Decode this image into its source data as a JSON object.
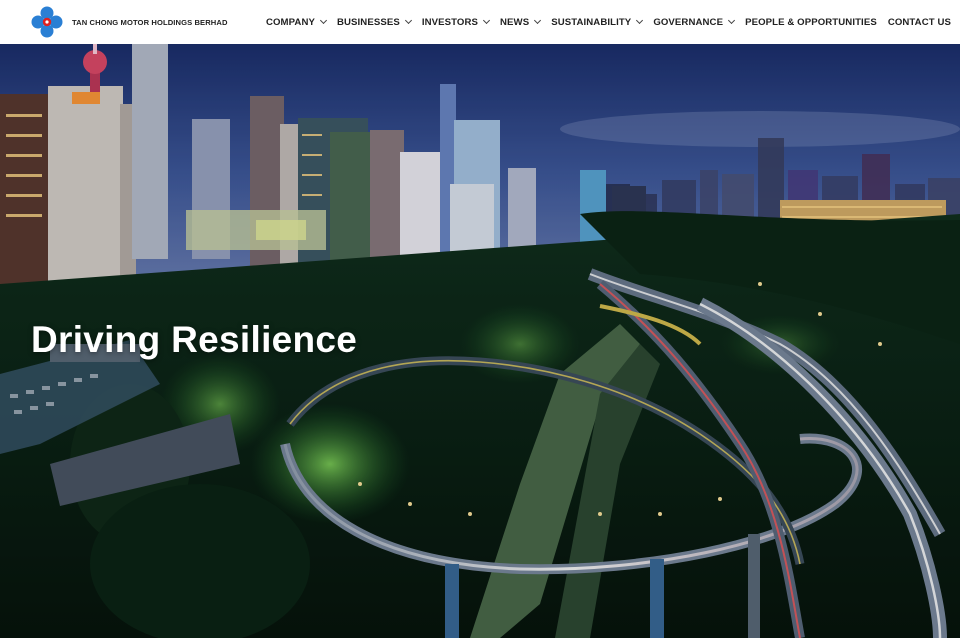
{
  "brand": {
    "name": "TAN CHONG MOTOR HOLDINGS BERHAD",
    "logo_icon": "four-circle-logo-icon",
    "colors": {
      "blue": "#2a7fd4",
      "red": "#e02020"
    }
  },
  "nav": {
    "items": [
      {
        "label": "COMPANY",
        "dropdown": true
      },
      {
        "label": "BUSINESSES",
        "dropdown": true
      },
      {
        "label": "INVESTORS",
        "dropdown": true
      },
      {
        "label": "NEWS",
        "dropdown": true
      },
      {
        "label": "SUSTAINABILITY",
        "dropdown": true
      },
      {
        "label": "GOVERNANCE",
        "dropdown": true
      },
      {
        "label": "PEOPLE & OPPORTUNITIES",
        "dropdown": false
      },
      {
        "label": "CONTACT US",
        "dropdown": false
      }
    ]
  },
  "hero": {
    "title": "Driving Resilience",
    "image_subject": "night-city-highway-photo"
  }
}
